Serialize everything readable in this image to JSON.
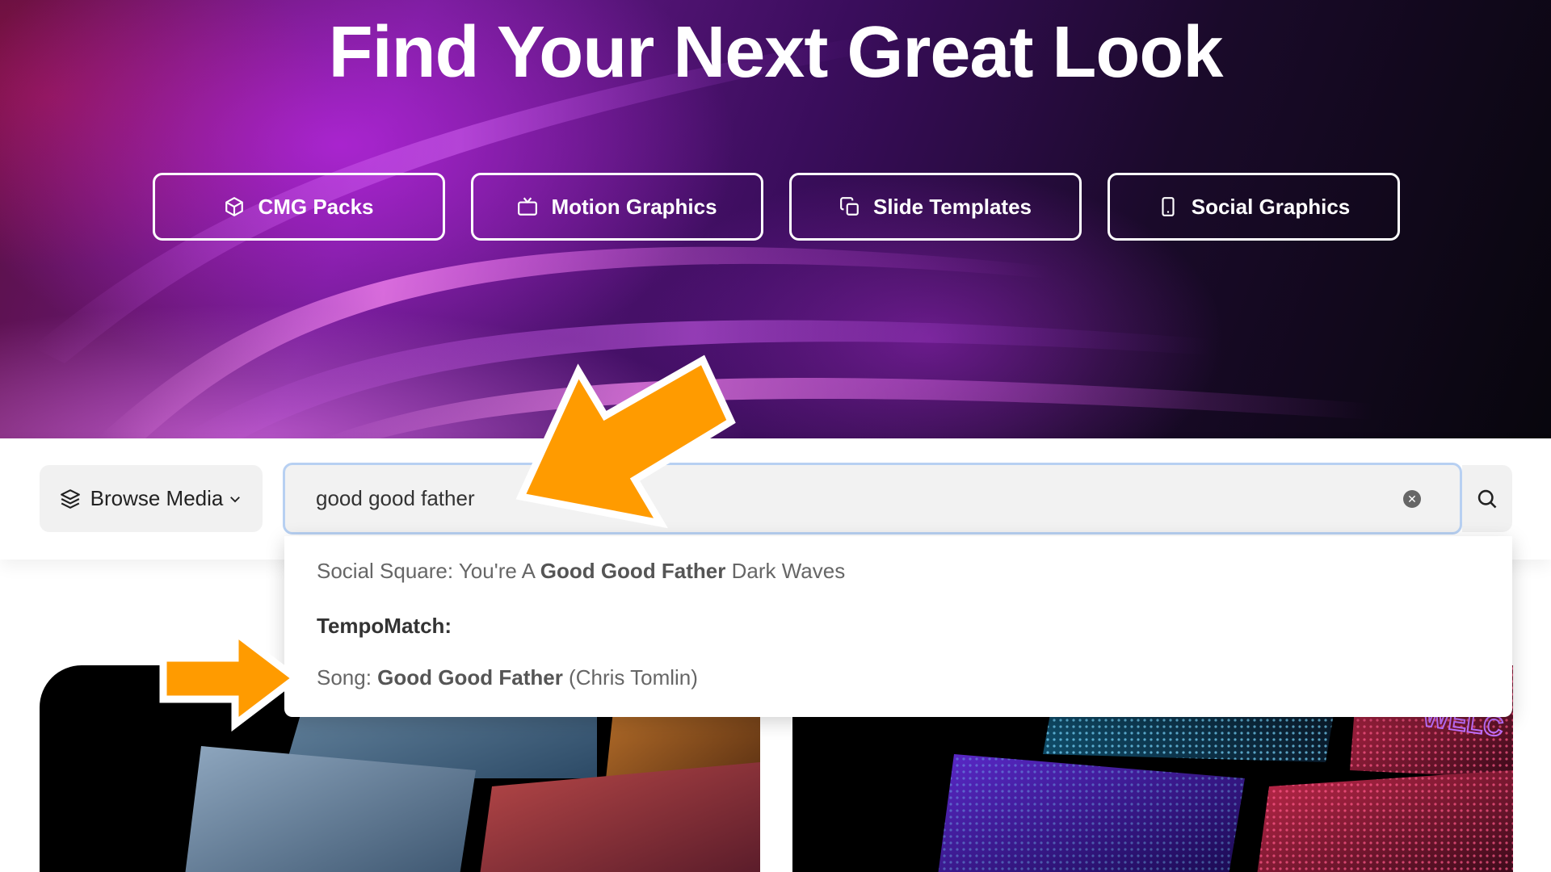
{
  "hero": {
    "title": "Find Your Next Great Look",
    "categories": [
      {
        "label": "CMG Packs",
        "icon": "package-icon"
      },
      {
        "label": "Motion Graphics",
        "icon": "tv-icon"
      },
      {
        "label": "Slide Templates",
        "icon": "copy-icon"
      },
      {
        "label": "Social Graphics",
        "icon": "phone-icon"
      }
    ]
  },
  "search": {
    "browse_label": "Browse Media",
    "browse_icon": "layers-icon",
    "value": "good good father",
    "clear_icon": "clear-icon",
    "submit_icon": "search-icon"
  },
  "suggestions": {
    "item1": {
      "prefix": "Social Square: You're A ",
      "match": "Good Good Father",
      "suffix": " Dark Waves"
    },
    "heading": "TempoMatch:",
    "item2": {
      "prefix": "Song: ",
      "match": "Good Good Father",
      "suffix": " (Chris Tomlin)"
    }
  },
  "cards": {
    "right_overlay_text": "WELC"
  },
  "colors": {
    "arrow": "#ff9b00",
    "search_border": "#b7d0f2",
    "hero_dark": "#08060d",
    "hero_purple": "#6a1a8c"
  }
}
